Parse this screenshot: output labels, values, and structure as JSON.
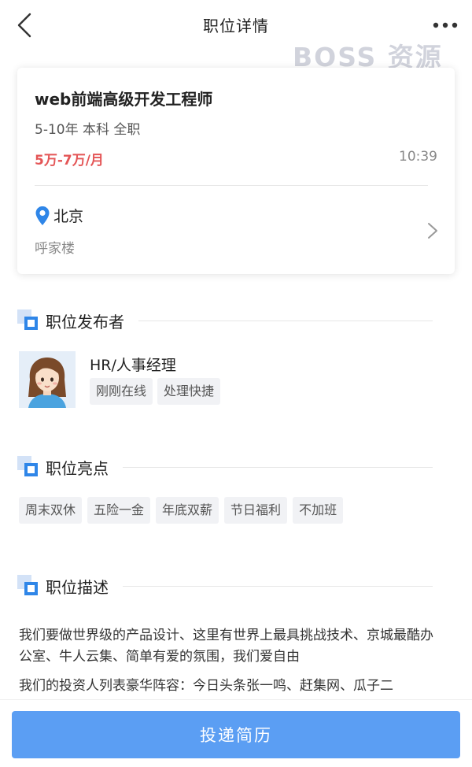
{
  "nav": {
    "title": "职位详情",
    "back_icon": "chevron-left-icon",
    "more_icon": "more-dots-icon"
  },
  "watermark": "BOSS 资源",
  "job": {
    "title": "web前端高级开发工程师",
    "requirements": "5-10年 本科 全职",
    "salary": "5万-7万/月",
    "time": "10:39",
    "location": {
      "city": "北京",
      "detail": "呼家楼"
    }
  },
  "publisher": {
    "section_title": "职位发布者",
    "name": "HR/人事经理",
    "tags": [
      "刚刚在线",
      "处理快捷"
    ]
  },
  "highlights": {
    "section_title": "职位亮点",
    "tags": [
      "周末双休",
      "五险一金",
      "年底双薪",
      "节日福利",
      "不加班"
    ]
  },
  "description": {
    "section_title": "职位描述",
    "paragraphs": [
      "我们要做世界级的产品设计、这里有世界上最具挑战技术、京城最酷办公室、牛人云集、简单有爱的氛围，我们爱自由",
      "我们的投资人列表豪华阵容：今日头条张一鸣、赶集网、瓜子二"
    ]
  },
  "apply_button": "投递简历",
  "colors": {
    "salary": "#e45556",
    "accent": "#2f86e8",
    "button": "#5b9ef3"
  }
}
